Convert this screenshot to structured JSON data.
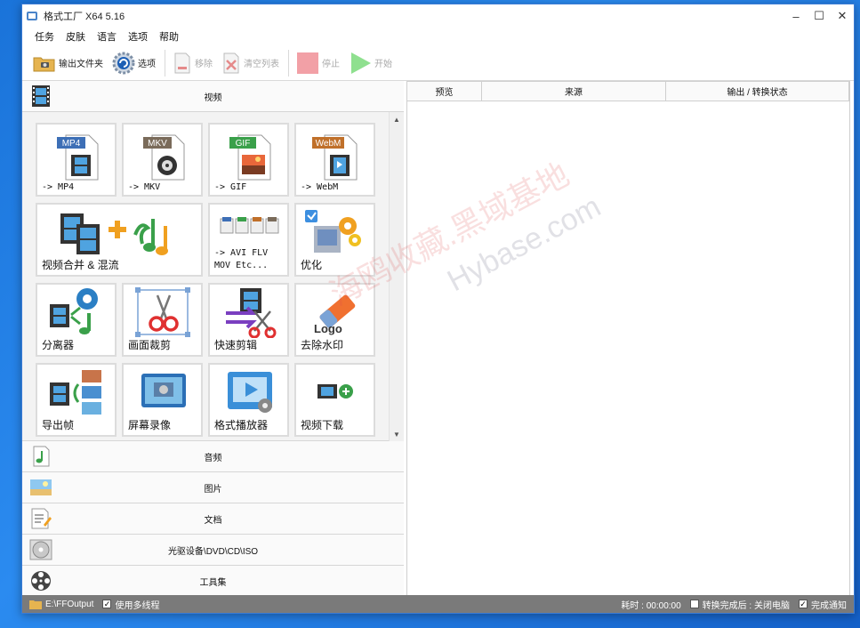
{
  "window": {
    "title": "格式工厂 X64 5.16"
  },
  "window_controls": {
    "minimize": "–",
    "maximize": "☐",
    "close": "✕"
  },
  "menu": [
    "任务",
    "皮肤",
    "语言",
    "选项",
    "帮助"
  ],
  "toolbar": {
    "output_folder": "输出文件夹",
    "options": "选项",
    "remove": "移除",
    "clear_list": "清空列表",
    "stop": "停止",
    "start": "开始"
  },
  "video_category": {
    "label": "视频"
  },
  "tiles": [
    {
      "label": "-> MP4",
      "badge": "MP4",
      "badge_color": "#3d6fb6"
    },
    {
      "label": "-> MKV",
      "badge": "MKV",
      "badge_color": "#7a6b5a"
    },
    {
      "label": "-> GIF",
      "badge": "GIF",
      "badge_color": "#3aa04a"
    },
    {
      "label": "-> WebM",
      "badge": "WebM",
      "badge_color": "#c0702a"
    },
    {
      "label": "视频合并 & 混流"
    },
    {
      "label": "-> AVI FLV MOV Etc..."
    },
    {
      "label": "优化"
    },
    {
      "label": "分离器"
    },
    {
      "label": "画面裁剪"
    },
    {
      "label": "快速剪辑"
    },
    {
      "label": "去除水印",
      "icon_text": "Logo"
    },
    {
      "label": "导出帧"
    },
    {
      "label": "屏幕录像"
    },
    {
      "label": "格式播放器"
    },
    {
      "label": "视频下载"
    }
  ],
  "categories": [
    {
      "label": "音频"
    },
    {
      "label": "图片"
    },
    {
      "label": "文档"
    },
    {
      "label": "光驱设备\\DVD\\CD\\ISO"
    },
    {
      "label": "工具集"
    }
  ],
  "list_columns": [
    "预览",
    "来源",
    "输出 / 转换状态"
  ],
  "status": {
    "output_path": "E:\\FFOutput",
    "multithread_label": "使用多线程",
    "multithread_checked": "✓",
    "elapsed": "耗时 : 00:00:00",
    "after_complete": "转换完成后 : 关闭电脑",
    "notify": "完成通知",
    "notify_checked": "✓"
  },
  "watermark": {
    "text1": "海鸥收藏.黑域基地",
    "text2": "Hybase.com"
  }
}
